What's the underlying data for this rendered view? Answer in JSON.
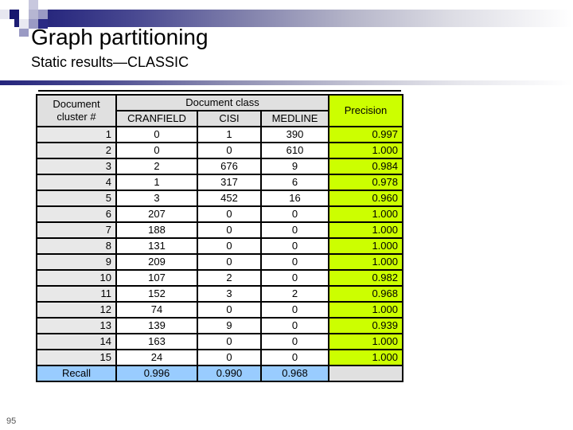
{
  "slide": {
    "title": "Graph partitioning",
    "subtitle": "Static results—CLASSIC",
    "page_number": "95"
  },
  "theme": {
    "accent_dark": "#1d1d74",
    "precision_fill": "#ccff00",
    "recall_fill": "#99ccff",
    "header_fill": "#e0e0e0",
    "cluster_fill": "#e8e8e8"
  },
  "table": {
    "group_headers": {
      "cluster": "Document cluster #",
      "cluster_line1": "Document",
      "cluster_line2": "cluster #",
      "document_class": "Document class",
      "precision": "Precision"
    },
    "columns": [
      "CRANFIELD",
      "CISI",
      "MEDLINE"
    ],
    "rows": [
      {
        "cluster": "1",
        "cranfield": "0",
        "cisi": "1",
        "medline": "390",
        "precision": "0.997"
      },
      {
        "cluster": "2",
        "cranfield": "0",
        "cisi": "0",
        "medline": "610",
        "precision": "1.000"
      },
      {
        "cluster": "3",
        "cranfield": "2",
        "cisi": "676",
        "medline": "9",
        "precision": "0.984"
      },
      {
        "cluster": "4",
        "cranfield": "1",
        "cisi": "317",
        "medline": "6",
        "precision": "0.978"
      },
      {
        "cluster": "5",
        "cranfield": "3",
        "cisi": "452",
        "medline": "16",
        "precision": "0.960"
      },
      {
        "cluster": "6",
        "cranfield": "207",
        "cisi": "0",
        "medline": "0",
        "precision": "1.000"
      },
      {
        "cluster": "7",
        "cranfield": "188",
        "cisi": "0",
        "medline": "0",
        "precision": "1.000"
      },
      {
        "cluster": "8",
        "cranfield": "131",
        "cisi": "0",
        "medline": "0",
        "precision": "1.000"
      },
      {
        "cluster": "9",
        "cranfield": "209",
        "cisi": "0",
        "medline": "0",
        "precision": "1.000"
      },
      {
        "cluster": "10",
        "cranfield": "107",
        "cisi": "2",
        "medline": "0",
        "precision": "0.982"
      },
      {
        "cluster": "11",
        "cranfield": "152",
        "cisi": "3",
        "medline": "2",
        "precision": "0.968"
      },
      {
        "cluster": "12",
        "cranfield": "74",
        "cisi": "0",
        "medline": "0",
        "precision": "1.000"
      },
      {
        "cluster": "13",
        "cranfield": "139",
        "cisi": "9",
        "medline": "0",
        "precision": "0.939"
      },
      {
        "cluster": "14",
        "cranfield": "163",
        "cisi": "0",
        "medline": "0",
        "precision": "1.000"
      },
      {
        "cluster": "15",
        "cranfield": "24",
        "cisi": "0",
        "medline": "0",
        "precision": "1.000"
      }
    ],
    "recall": {
      "label": "Recall",
      "cranfield": "0.996",
      "cisi": "0.990",
      "medline": "0.968",
      "precision": ""
    }
  }
}
